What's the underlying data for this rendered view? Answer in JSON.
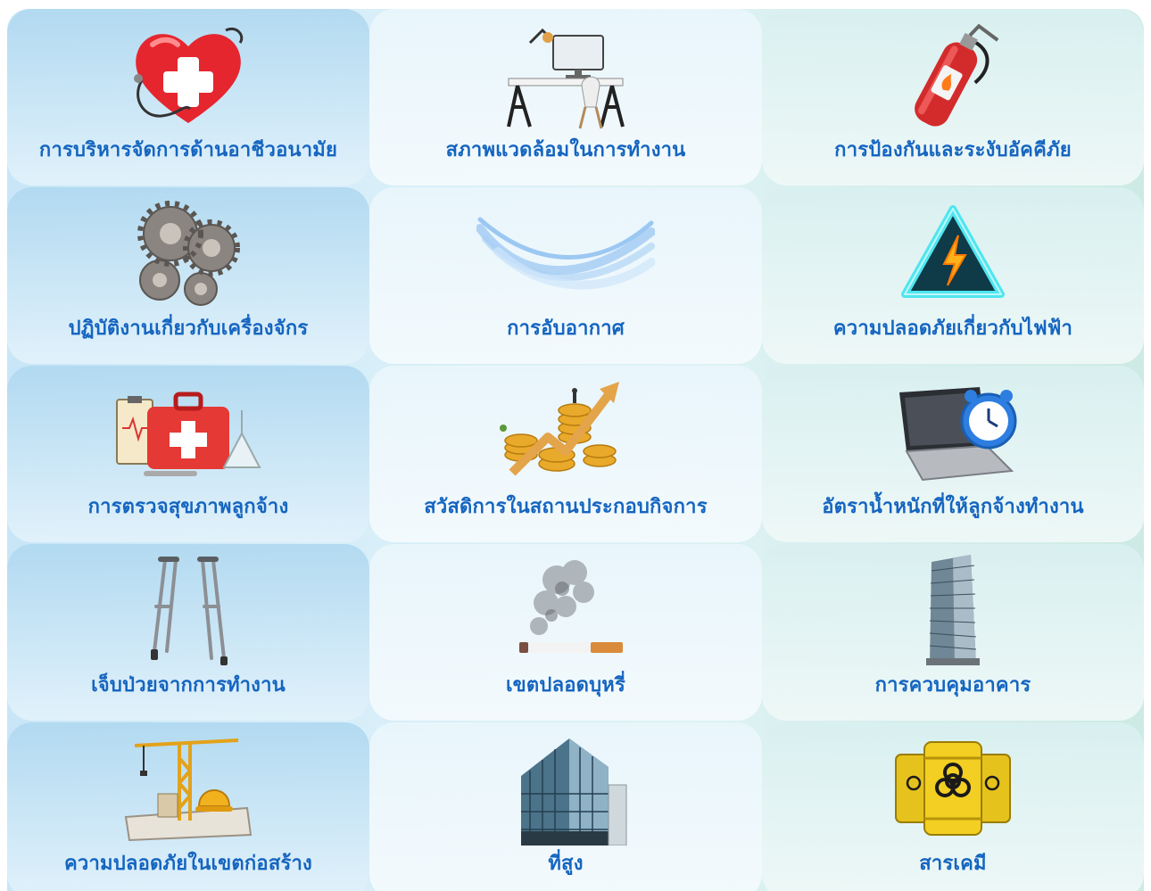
{
  "grid": {
    "tiles": [
      {
        "label": "การบริหารจัดการด้านอาชีวอนามัย",
        "icon": "heart-stethoscope-icon"
      },
      {
        "label": "สภาพแวดล้อมในการทำงาน",
        "icon": "desk-workspace-icon"
      },
      {
        "label": "การป้องกันและระงับอัคคีภัย",
        "icon": "fire-extinguisher-icon"
      },
      {
        "label": "ปฏิบัติงานเกี่ยวกับเครื่องจักร",
        "icon": "gears-icon"
      },
      {
        "label": "การอับอากาศ",
        "icon": "airflow-icon"
      },
      {
        "label": "ความปลอดภัยเกี่ยวกับไฟฟ้า",
        "icon": "electric-warning-icon"
      },
      {
        "label": "การตรวจสุขภาพลูกจ้าง",
        "icon": "first-aid-kit-icon"
      },
      {
        "label": "สวัสดิการในสถานประกอบกิจการ",
        "icon": "coins-growth-icon"
      },
      {
        "label": "อัตราน้ำหนักที่ให้ลูกจ้างทำงาน",
        "icon": "laptop-clock-icon"
      },
      {
        "label": "เจ็บป่วยจากการทำงาน",
        "icon": "crutches-icon"
      },
      {
        "label": "เขตปลอดบุหรี่",
        "icon": "cigarette-smoke-icon"
      },
      {
        "label": "การควบคุมอาคาร",
        "icon": "office-tower-icon"
      },
      {
        "label": "ความปลอดภัยในเขตก่อสร้าง",
        "icon": "construction-crane-icon"
      },
      {
        "label": "ที่สูง",
        "icon": "skyscraper-icon"
      },
      {
        "label": "สารเคมี",
        "icon": "biohazard-barrels-icon"
      }
    ]
  },
  "colors": {
    "label": "#1565c0",
    "panel_left": "#c8e6f7",
    "panel_right": "#cdeae4"
  }
}
